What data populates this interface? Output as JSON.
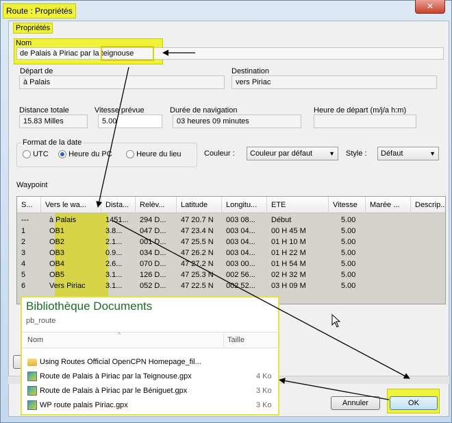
{
  "window": {
    "title": "Route : Propriétés",
    "close_glyph": "✕"
  },
  "properties": {
    "section_label": "Propriétés",
    "name": {
      "label": "Nom",
      "value": "de Palais à Piriac par la teignouse"
    },
    "departure": {
      "label": "Départ de",
      "value": "à Palais"
    },
    "destination": {
      "label": "Destination",
      "value": "vers Piriac"
    },
    "distance": {
      "label": "Distance totale",
      "value": "15.83 Milles"
    },
    "speed": {
      "label": "Vitesse prévue",
      "value": "5.00"
    },
    "duration": {
      "label": "Durée de navigation",
      "value": "03 heures  09 minutes"
    },
    "start_time": {
      "label": "Heure de départ (m/j/a h:m)",
      "value": ""
    },
    "date_format": {
      "label": "Format de la date",
      "options": [
        "UTC",
        "Heure du PC",
        "Heure du lieu"
      ],
      "selected": "Heure du PC"
    },
    "color": {
      "label": "Couleur :",
      "value": "Couleur par défaut"
    },
    "style": {
      "label": "Style :",
      "value": "Défaut"
    }
  },
  "waypoints": {
    "section_label": "Waypoint",
    "columns": [
      "S...",
      "Vers le wa...",
      "Dista...",
      "Relèv...",
      "Latitude",
      "Longitu...",
      "ETE",
      "Vitesse",
      "Marée ...",
      "Descrip..."
    ],
    "rows": [
      [
        "---",
        "à Palais",
        "1451...",
        "294 D...",
        "47 20.7 N",
        "003 08...",
        "Début",
        "5.00",
        "",
        ""
      ],
      [
        "1",
        "OB1",
        "3.8...",
        "047 D...",
        "47 23.4 N",
        "003 04...",
        "00 H  45 M",
        "5.00",
        "",
        ""
      ],
      [
        "2",
        "OB2",
        "2.1...",
        "001 D...",
        "47 25.5 N",
        "003 04...",
        "01 H  10 M",
        "5.00",
        "",
        ""
      ],
      [
        "3",
        "OB3",
        "0.9...",
        "034 D...",
        "47 26.2 N",
        "003 04...",
        "01 H  22 M",
        "5.00",
        "",
        ""
      ],
      [
        "4",
        "OB4",
        "2.6...",
        "070 D...",
        "47 27.2 N",
        "003 00...",
        "01 H  54 M",
        "5.00",
        "",
        ""
      ],
      [
        "5",
        "OB5",
        "3.1...",
        "126 D...",
        "47 25.3 N",
        "002 56...",
        "02 H  32 M",
        "5.00",
        "",
        ""
      ],
      [
        "6",
        "Vers Piriac",
        "3.1...",
        "052 D...",
        "47 22.5 N",
        "002 52...",
        "03 H  09 M",
        "5.00",
        "",
        ""
      ]
    ]
  },
  "buttons": {
    "cancel": "Annuler",
    "ok": "OK"
  },
  "explorer": {
    "title": "Bibliothèque Documents",
    "subtitle": "pb_route",
    "col_name": "Nom",
    "col_size": "Taille",
    "files": [
      {
        "name": "Using Routes   Official OpenCPN Homepage_fil...",
        "size": "",
        "icon": "folder-icon"
      },
      {
        "name": "Route de Palais à Piriac par la Teignouse.gpx",
        "size": "4 Ko",
        "icon": "gpx-file-icon"
      },
      {
        "name": "Route de Palais à Piriac par le Béniguet.gpx",
        "size": "3 Ko",
        "icon": "gpx-file-icon"
      },
      {
        "name": "WP route palais Piriac.gpx",
        "size": "3 Ko",
        "icon": "gpx-file-icon"
      }
    ]
  },
  "colors": {
    "highlight": "#f0f23a",
    "title_green": "#1d6a2a",
    "close_red": "#c7432e"
  }
}
